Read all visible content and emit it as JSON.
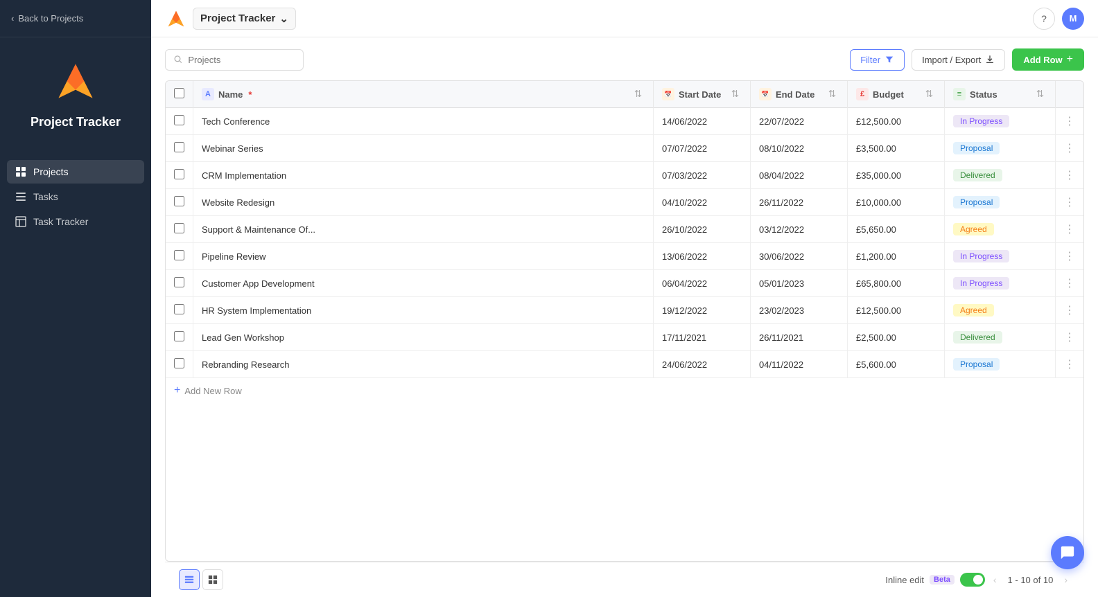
{
  "sidebar": {
    "back_label": "Back to Projects",
    "app_title": "Project Tracker",
    "nav_items": [
      {
        "id": "projects",
        "label": "Projects",
        "icon": "grid",
        "active": true
      },
      {
        "id": "tasks",
        "label": "Tasks",
        "icon": "tasks",
        "active": false
      },
      {
        "id": "task-tracker",
        "label": "Task Tracker",
        "icon": "table",
        "active": false
      }
    ]
  },
  "topbar": {
    "title": "Project Tracker",
    "help_label": "?",
    "avatar_label": "M"
  },
  "toolbar": {
    "search_placeholder": "Projects",
    "filter_label": "Filter",
    "import_export_label": "Import / Export",
    "add_row_label": "Add Row"
  },
  "table": {
    "columns": [
      {
        "id": "name",
        "label": "Name",
        "required": true,
        "icon_type": "A",
        "icon_class": "th-icon-name"
      },
      {
        "id": "start_date",
        "label": "Start Date",
        "icon_type": "📅",
        "icon_class": "th-icon-date"
      },
      {
        "id": "end_date",
        "label": "End Date",
        "icon_type": "📅",
        "icon_class": "th-icon-date"
      },
      {
        "id": "budget",
        "label": "Budget",
        "icon_type": "£",
        "icon_class": "th-icon-budget"
      },
      {
        "id": "status",
        "label": "Status",
        "icon_type": "≡",
        "icon_class": "th-icon-status"
      }
    ],
    "rows": [
      {
        "name": "Tech Conference",
        "start_date": "14/06/2022",
        "end_date": "22/07/2022",
        "budget": "£12,500.00",
        "status": "In Progress",
        "status_class": "status-in-progress"
      },
      {
        "name": "Webinar Series",
        "start_date": "07/07/2022",
        "end_date": "08/10/2022",
        "budget": "£3,500.00",
        "status": "Proposal",
        "status_class": "status-proposal"
      },
      {
        "name": "CRM Implementation",
        "start_date": "07/03/2022",
        "end_date": "08/04/2022",
        "budget": "£35,000.00",
        "status": "Delivered",
        "status_class": "status-delivered"
      },
      {
        "name": "Website Redesign",
        "start_date": "04/10/2022",
        "end_date": "26/11/2022",
        "budget": "£10,000.00",
        "status": "Proposal",
        "status_class": "status-proposal"
      },
      {
        "name": "Support & Maintenance Of...",
        "start_date": "26/10/2022",
        "end_date": "03/12/2022",
        "budget": "£5,650.00",
        "status": "Agreed",
        "status_class": "status-agreed"
      },
      {
        "name": "Pipeline Review",
        "start_date": "13/06/2022",
        "end_date": "30/06/2022",
        "budget": "£1,200.00",
        "status": "In Progress",
        "status_class": "status-in-progress"
      },
      {
        "name": "Customer App Development",
        "start_date": "06/04/2022",
        "end_date": "05/01/2023",
        "budget": "£65,800.00",
        "status": "In Progress",
        "status_class": "status-in-progress"
      },
      {
        "name": "HR System Implementation",
        "start_date": "19/12/2022",
        "end_date": "23/02/2023",
        "budget": "£12,500.00",
        "status": "Agreed",
        "status_class": "status-agreed"
      },
      {
        "name": "Lead Gen Workshop",
        "start_date": "17/11/2021",
        "end_date": "26/11/2021",
        "budget": "£2,500.00",
        "status": "Delivered",
        "status_class": "status-delivered"
      },
      {
        "name": "Rebranding Research",
        "start_date": "24/06/2022",
        "end_date": "04/11/2022",
        "budget": "£5,600.00",
        "status": "Proposal",
        "status_class": "status-proposal"
      }
    ],
    "add_row_label": "Add New Row"
  },
  "bottombar": {
    "inline_edit_label": "Inline edit",
    "beta_label": "Beta",
    "pagination_label": "1 - 10 of 10"
  }
}
